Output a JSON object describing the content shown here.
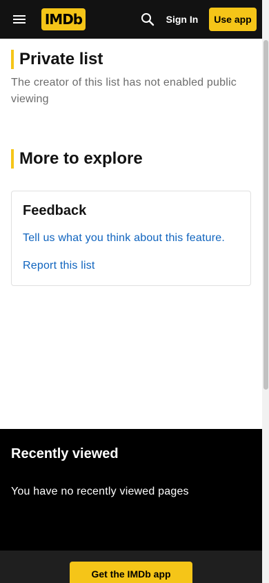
{
  "header": {
    "menu_icon": "hamburger-menu-icon",
    "logo_text": "IMDb",
    "search_icon": "search-icon",
    "sign_in_label": "Sign In",
    "use_app_label": "Use app"
  },
  "private_list": {
    "title": "Private list",
    "description": "The creator of this list has not enabled public viewing"
  },
  "more_to_explore": {
    "title": "More to explore",
    "feedback": {
      "title": "Feedback",
      "tell_us_link": "Tell us what you think about this feature.",
      "report_link": "Report this list"
    }
  },
  "recently_viewed": {
    "title": "Recently viewed",
    "empty_text": "You have no recently viewed pages"
  },
  "footer": {
    "get_app_label": "Get the IMDb app"
  },
  "colors": {
    "brand_yellow": "#f5c518",
    "header_bg": "#121212",
    "link_blue": "#0e63be"
  }
}
